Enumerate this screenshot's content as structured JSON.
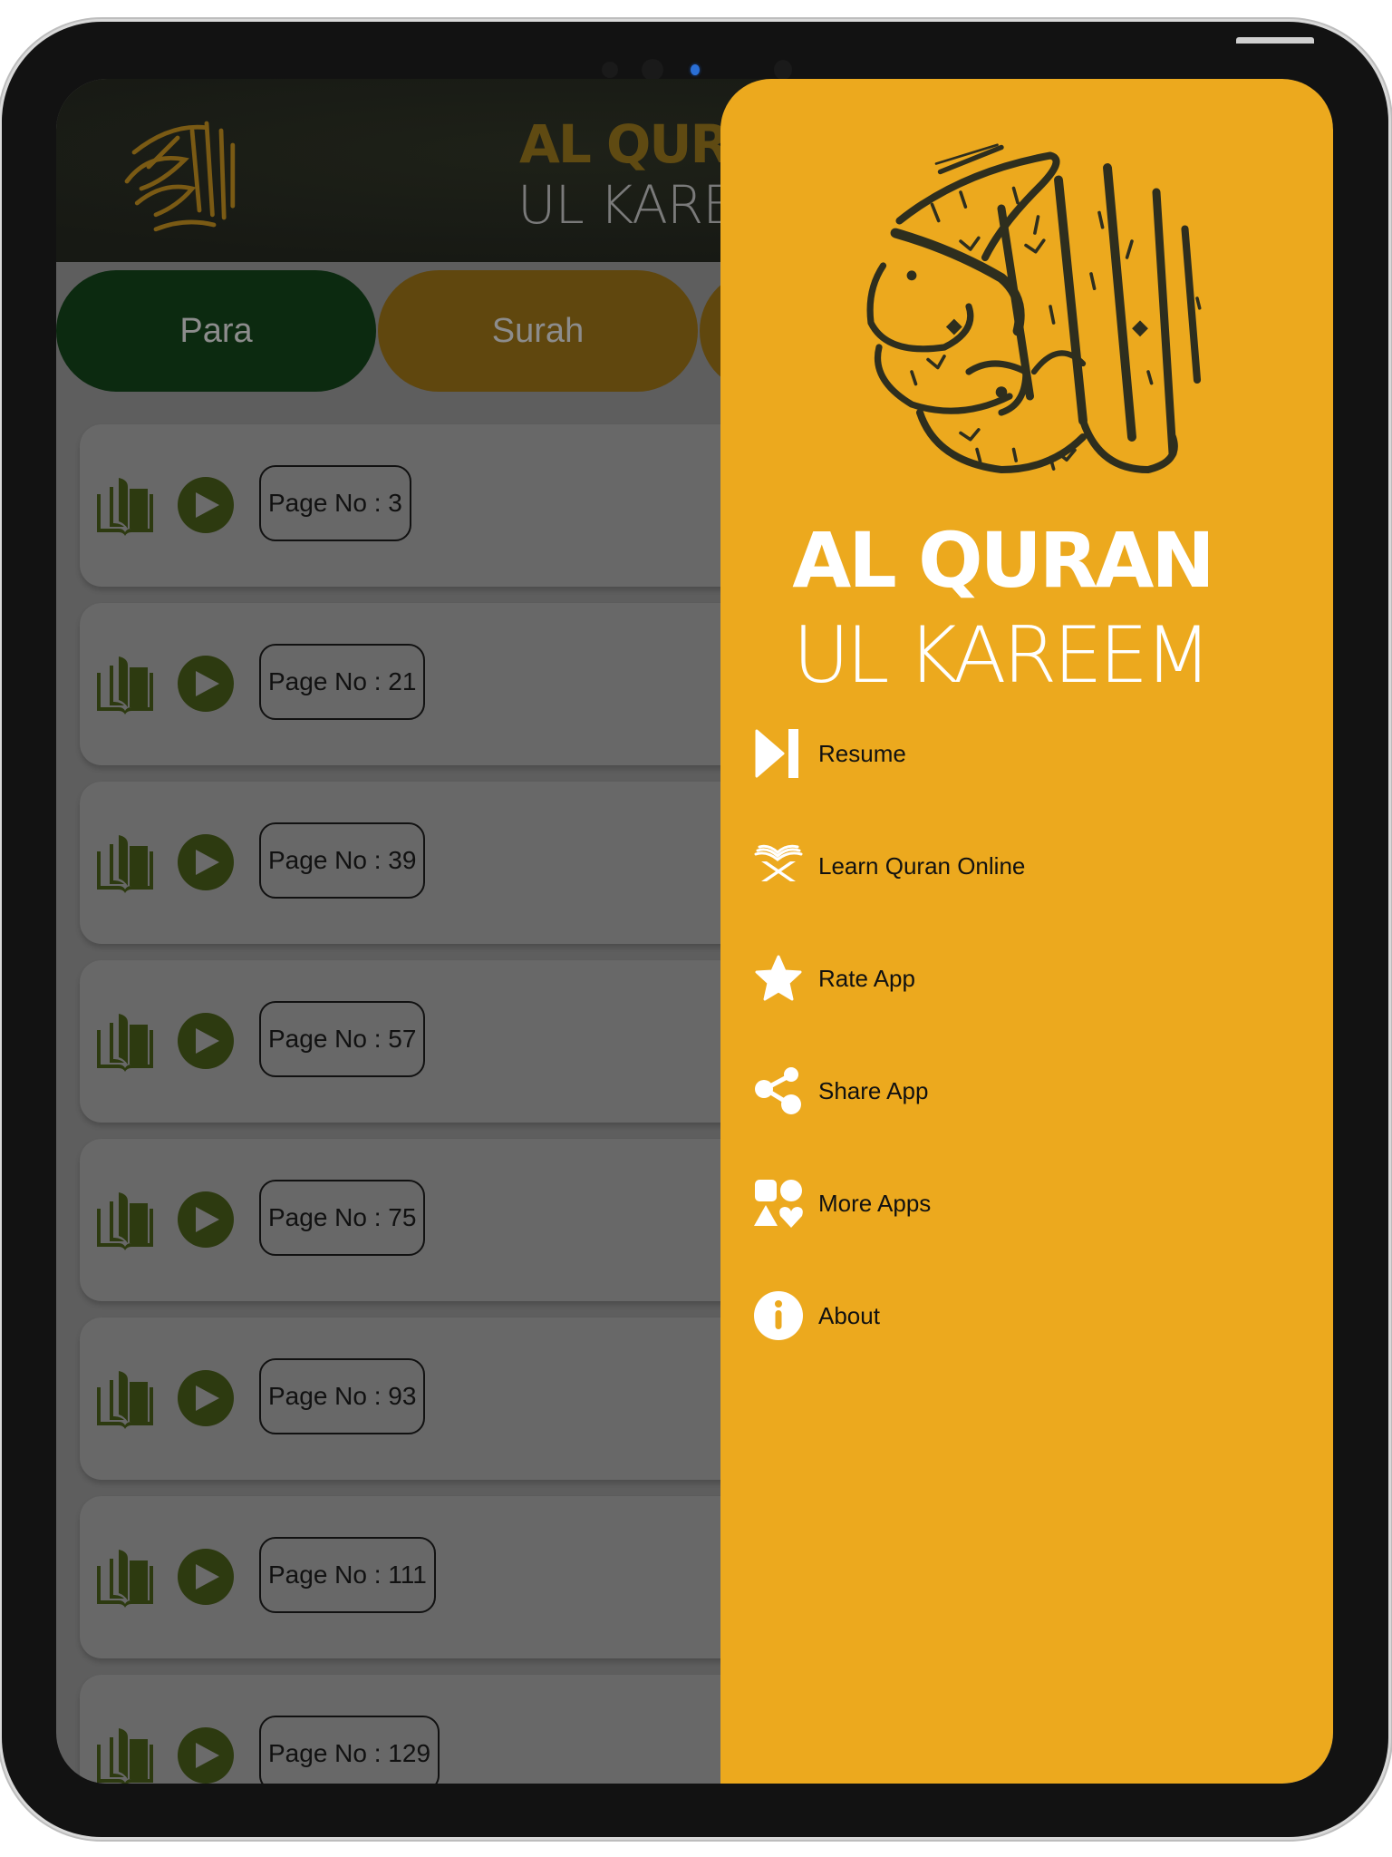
{
  "app": {
    "header_title_line1": "AL QURAN",
    "header_title_line2": "UL KAREEM"
  },
  "tabs": [
    {
      "label": "Para",
      "active": true
    },
    {
      "label": "Surah",
      "active": false
    },
    {
      "label": "",
      "active": false
    }
  ],
  "list": {
    "rows": [
      {
        "page_label": "Page No : 3"
      },
      {
        "page_label": "Page No : 21"
      },
      {
        "page_label": "Page No : 39"
      },
      {
        "page_label": "Page No : 57"
      },
      {
        "page_label": "Page No : 75"
      },
      {
        "page_label": "Page No : 93"
      },
      {
        "page_label": "Page No : 111"
      },
      {
        "page_label": "Page No : 129"
      }
    ],
    "row_icons": [
      "book-open-icon",
      "play-icon"
    ]
  },
  "drawer": {
    "title_line1": "AL QURAN",
    "title_line2": "UL KAREEM",
    "logo": "quran-calligraphy-logo",
    "items": [
      {
        "label": "Resume",
        "icon": "skip-next-icon"
      },
      {
        "label": "Learn Quran Online",
        "icon": "quran-stand-icon"
      },
      {
        "label": "Rate App",
        "icon": "star-icon"
      },
      {
        "label": "Share App",
        "icon": "share-icon"
      },
      {
        "label": "More Apps",
        "icon": "shapes-icon"
      },
      {
        "label": "About",
        "icon": "info-icon"
      }
    ]
  },
  "colors": {
    "drawer_bg": "#ECA91E",
    "drawer_text": "#111111",
    "drawer_icon": "#FFFFFF",
    "calligraphy": "#2E2E1E",
    "tab_active": "#0C2A10",
    "tab_inactive": "#60470E",
    "play_button": "#2D3A10",
    "card_bg": "#686868",
    "list_bg": "#5E5E5E"
  }
}
